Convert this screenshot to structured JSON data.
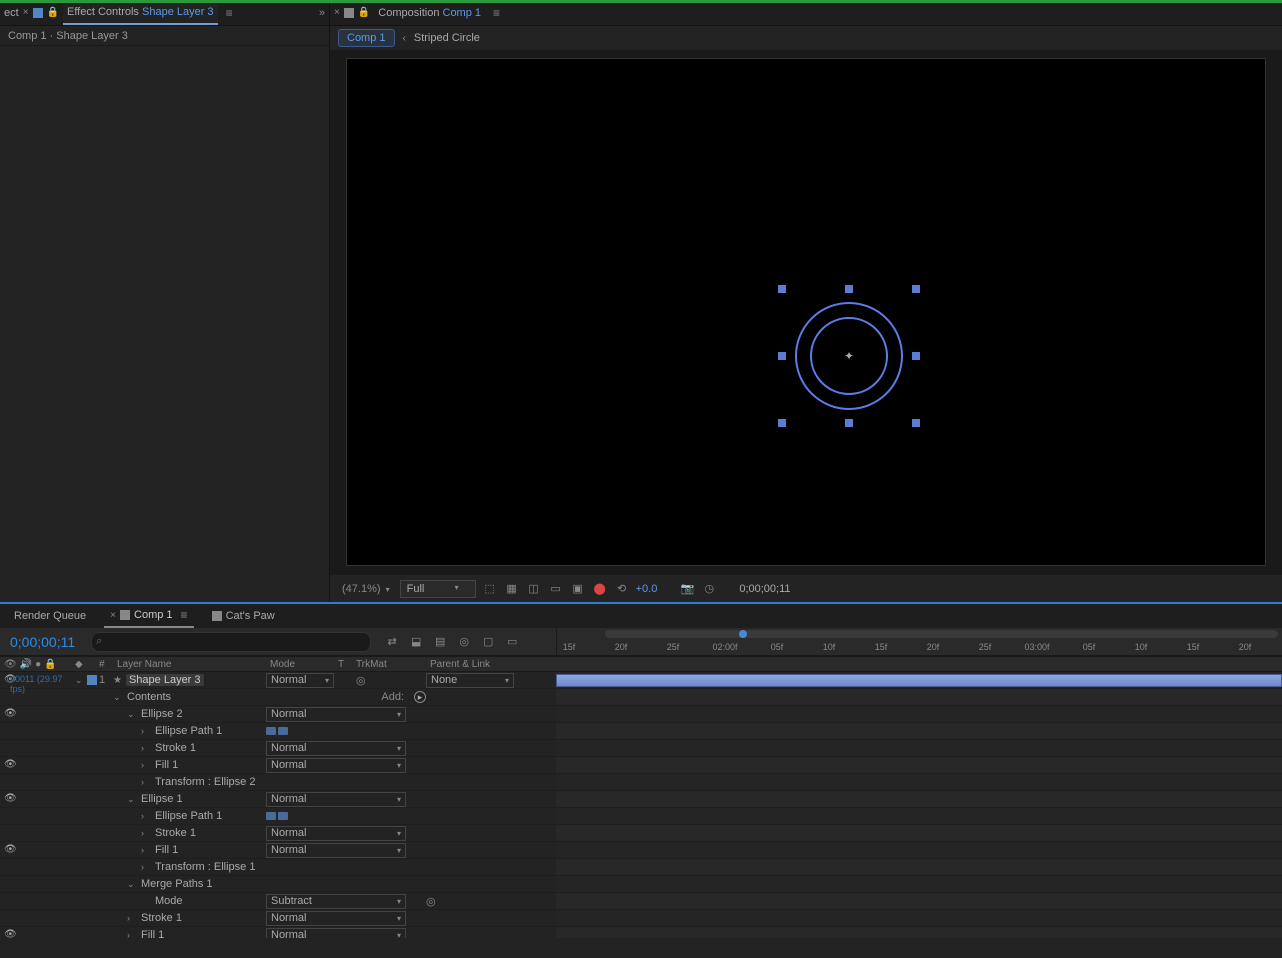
{
  "top": {
    "left_tab_prefix": "ect",
    "effect_controls_label": "Effect Controls",
    "effect_controls_target": "Shape Layer 3",
    "breadcrumb": "Comp 1 · Shape Layer 3",
    "composition_label": "Composition",
    "composition_target": "Comp 1",
    "comp_nav_active": "Comp 1",
    "comp_nav_secondary": "Striped Circle"
  },
  "viewer": {
    "zoom": "(47.1%)",
    "resolution": "Full",
    "exposure": "+0.0",
    "timecode": "0;00;00;11"
  },
  "bottom_tabs": {
    "render_queue": "Render Queue",
    "comp1": "Comp 1",
    "cats_paw": "Cat's Paw"
  },
  "timeline": {
    "timecode": "0;00;00;11",
    "timecode_sub": "00011 (29.97 fps)"
  },
  "columns": {
    "num": "#",
    "layer_name": "Layer Name",
    "mode": "Mode",
    "t": "T",
    "trkmat": "TrkMat",
    "parent": "Parent & Link"
  },
  "layer": {
    "number": "1",
    "name": "Shape Layer 3",
    "mode": "Normal",
    "parent": "None",
    "contents": "Contents",
    "add": "Add:",
    "ellipse2": "Ellipse 2",
    "ellipse_path1": "Ellipse Path 1",
    "stroke1": "Stroke 1",
    "fill1": "Fill 1",
    "transform_ellipse2": "Transform : Ellipse 2",
    "ellipse1": "Ellipse 1",
    "transform_ellipse1": "Transform : Ellipse 1",
    "merge_paths1": "Merge Paths 1",
    "mode_prop": "Mode",
    "subtract": "Subtract",
    "normal": "Normal"
  },
  "ruler": {
    "ticks": [
      "15f",
      "20f",
      "25f",
      "02:00f",
      "05f",
      "10f",
      "15f",
      "20f",
      "25f",
      "03:00f",
      "05f",
      "10f",
      "15f",
      "20f"
    ]
  }
}
